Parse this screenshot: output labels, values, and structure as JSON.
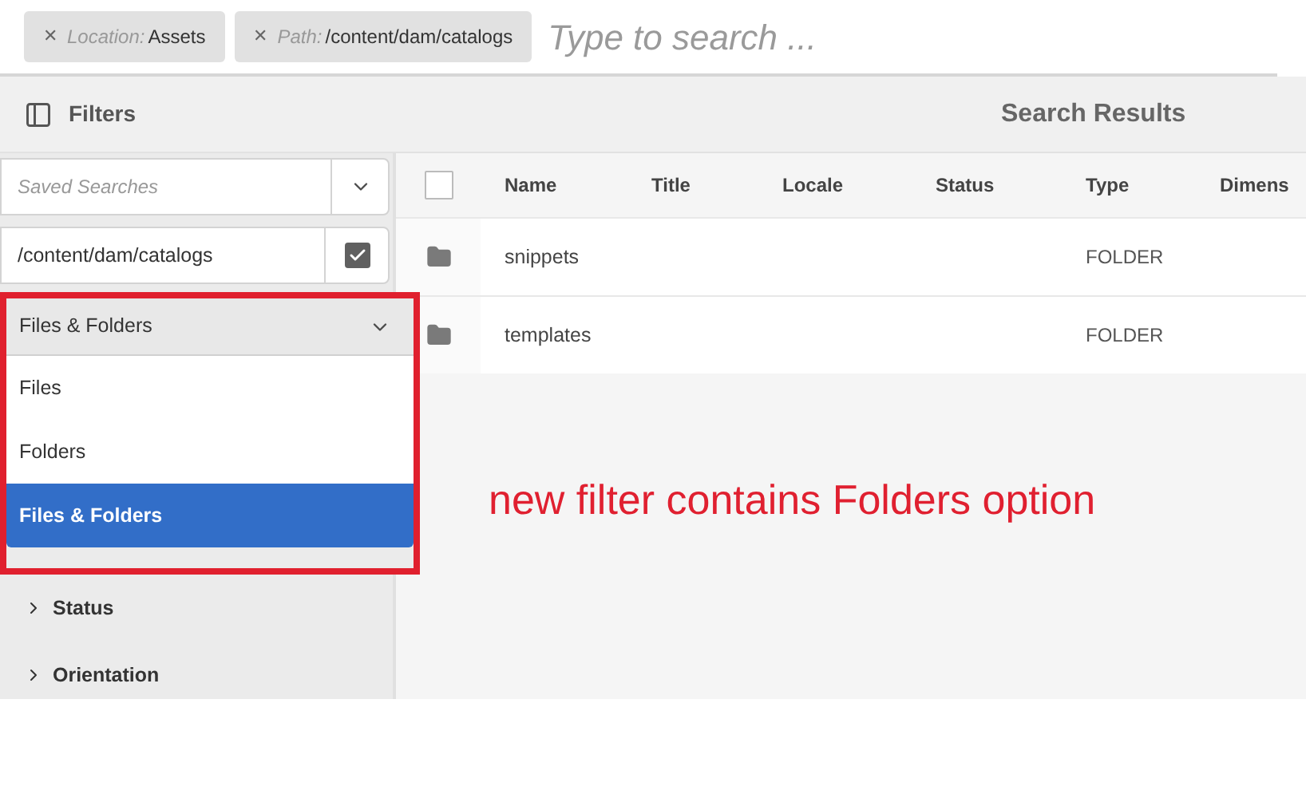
{
  "search_bar": {
    "tags": [
      {
        "label": "Location:",
        "value": "Assets",
        "remove": "✕"
      },
      {
        "label": "Path:",
        "value": "/content/dam/catalogs",
        "remove": "✕"
      }
    ],
    "placeholder": "Type to search ..."
  },
  "header": {
    "filters_title": "Filters",
    "results_title": "Search Results"
  },
  "sidebar": {
    "saved_searches": {
      "placeholder": "Saved Searches"
    },
    "path": {
      "value": "/content/dam/catalogs",
      "checked": true
    },
    "type_select": {
      "value": "Files & Folders",
      "expanded": true,
      "options": [
        {
          "label": "Files",
          "selected": false
        },
        {
          "label": "Folders",
          "selected": false
        },
        {
          "label": "Files & Folders",
          "selected": true
        }
      ]
    },
    "sections": [
      {
        "label": "Status",
        "expanded": false
      },
      {
        "label": "Orientation",
        "expanded": false
      }
    ]
  },
  "table": {
    "select_all": {
      "checked": false
    },
    "columns": [
      "Name",
      "Title",
      "Locale",
      "Status",
      "Type",
      "Dimens"
    ],
    "rows": [
      {
        "name": "snippets",
        "type": "FOLDER",
        "selected": false
      },
      {
        "name": "templates",
        "type": "FOLDER",
        "selected": false
      }
    ]
  },
  "annotation": {
    "text": "new filter contains Folders option"
  }
}
